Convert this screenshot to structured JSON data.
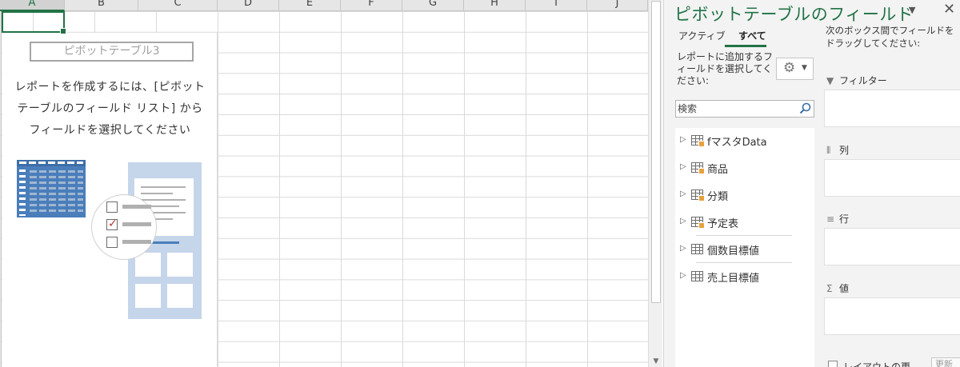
{
  "sheet": {
    "columns": [
      "A",
      "B",
      "C",
      "D",
      "E",
      "F",
      "G",
      "H",
      "I",
      "J"
    ],
    "pivot": {
      "name": "ピボットテーブル3",
      "instruction_lines": [
        "レポートを作成するには、[ピボット",
        "テーブルのフィールド リスト] から",
        "フィールドを選択してください"
      ]
    }
  },
  "pane": {
    "title": "ピボットテーブルのフィールド",
    "tabs": [
      {
        "label": "アクティブ",
        "active": false
      },
      {
        "label": "すべて",
        "active": true
      }
    ],
    "choose_label": "レポートに追加するフィールドを選択してください:",
    "search": {
      "placeholder": "検索",
      "value": ""
    },
    "fields": [
      {
        "label": "fマスタData",
        "type": "table-cube"
      },
      {
        "label": "商品",
        "type": "table-cube"
      },
      {
        "label": "分類",
        "type": "table-cube"
      },
      {
        "label": "予定表",
        "type": "table-cube"
      },
      {
        "label": "個数目標値",
        "type": "table"
      },
      {
        "label": "売上目標値",
        "type": "table"
      }
    ],
    "drag_label": "次のボックス間でフィールドをドラッグしてください:",
    "areas": [
      {
        "label": "フィルター",
        "icon": "filter-icon"
      },
      {
        "label": "列",
        "icon": "columns-icon"
      },
      {
        "label": "行",
        "icon": "rows-icon"
      },
      {
        "label": "値",
        "icon": "sigma-icon"
      }
    ],
    "defer_label": "レイアウトの更",
    "update_label": "更新"
  },
  "colors": {
    "accent": "#217346",
    "illustration_blue": "#4a7ebb",
    "illustration_light": "#c5d5ea",
    "check_red": "#c0392b"
  }
}
